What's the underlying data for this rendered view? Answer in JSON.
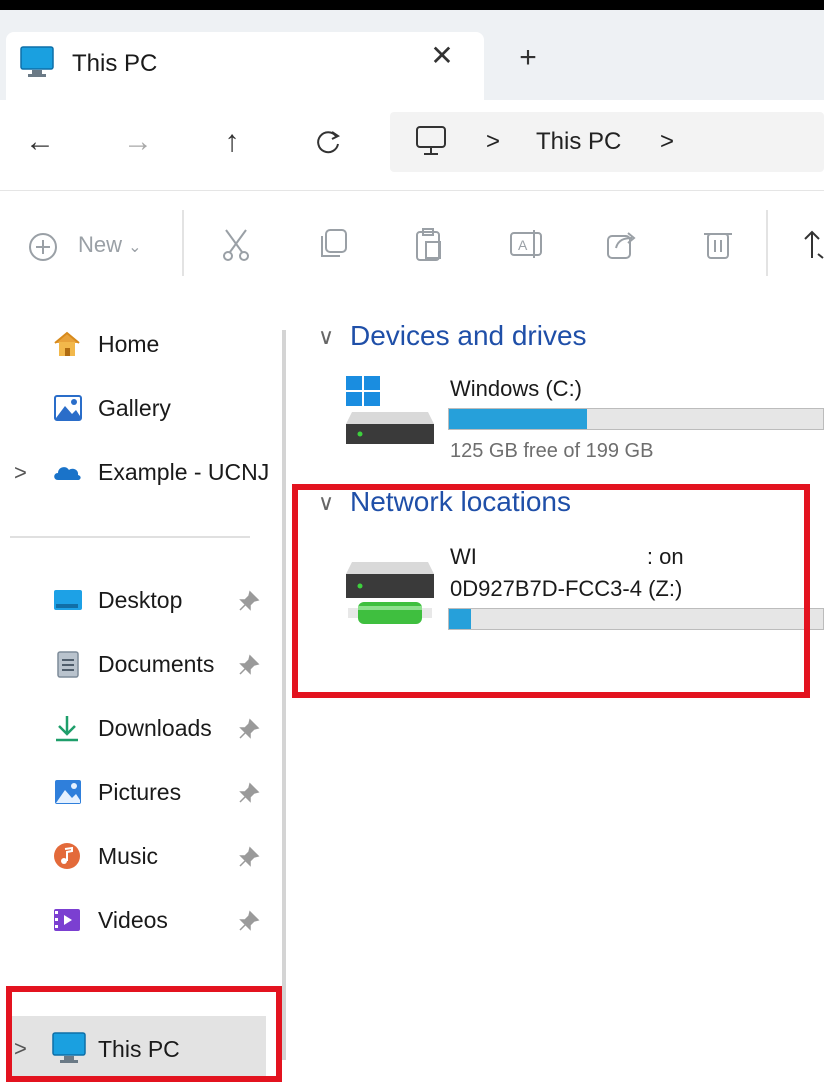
{
  "window": {
    "tab_title": "This PC",
    "close_glyph": "✕",
    "new_tab_glyph": "+"
  },
  "navigation": {
    "back": "←",
    "forward": "→",
    "up": "↑",
    "refresh": "C",
    "breadcrumb": [
      "This PC"
    ],
    "separator": ">"
  },
  "toolbar": {
    "new_label": "New",
    "new_chevron": "⌄",
    "icons": [
      "cut-icon",
      "copy-icon",
      "paste-icon",
      "rename-icon",
      "share-icon",
      "delete-icon",
      "sort-icon"
    ]
  },
  "sidebar": {
    "items": [
      {
        "label": "Home",
        "icon": "home-icon"
      },
      {
        "label": "Gallery",
        "icon": "gallery-icon"
      },
      {
        "label": "Example - UCNJ",
        "icon": "cloud-icon"
      }
    ],
    "quick_access": [
      {
        "label": "Desktop",
        "icon": "desktop-icon",
        "pinned": true
      },
      {
        "label": "Documents",
        "icon": "documents-icon",
        "pinned": true
      },
      {
        "label": "Downloads",
        "icon": "downloads-icon",
        "pinned": true
      },
      {
        "label": "Pictures",
        "icon": "pictures-icon",
        "pinned": true
      },
      {
        "label": "Music",
        "icon": "music-icon",
        "pinned": true
      },
      {
        "label": "Videos",
        "icon": "videos-icon",
        "pinned": true
      }
    ],
    "this_pc": "This PC",
    "expand_glyph": ">"
  },
  "content": {
    "devices_section": "Devices and drives",
    "network_section": "Network locations",
    "section_chevron": "∨",
    "drives": [
      {
        "name": "Windows (C:)",
        "free_text": "125 GB free of 199 GB",
        "used_fraction": 0.37
      }
    ],
    "network_drives": [
      {
        "name_line1_start": "WI",
        "name_line1_end": ": on",
        "name_line2": "0D927B7D-FCC3-4 (Z:)",
        "used_fraction": 0.06
      }
    ]
  },
  "colors": {
    "accent": "#26a0da",
    "section_text": "#1f4fa8",
    "highlight_red": "#e3131f",
    "selection": "#e3e3e3"
  }
}
